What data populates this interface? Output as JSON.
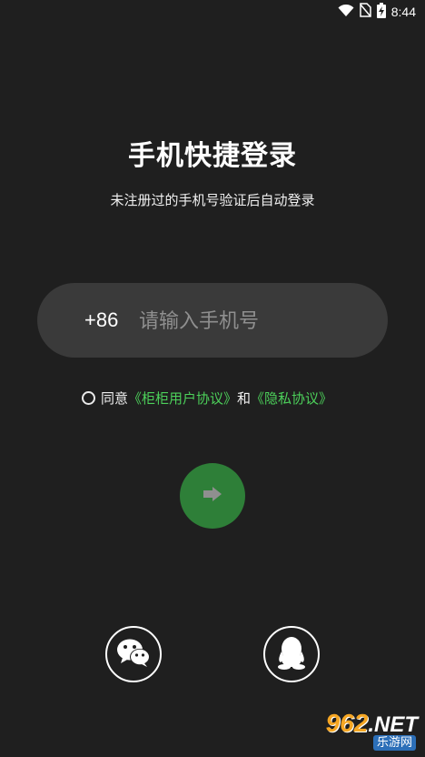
{
  "status_bar": {
    "time": "8:44",
    "icons": [
      "wifi-icon",
      "no-sim-icon",
      "battery-charging-icon"
    ]
  },
  "login": {
    "title": "手机快捷登录",
    "subtitle": "未注册过的手机号验证后自动登录",
    "country_code": "+86",
    "phone_placeholder": "请输入手机号",
    "phone_value": ""
  },
  "agreement": {
    "prefix": "同意",
    "user_agreement": "《柜柜用户协议》",
    "conjunction": "和",
    "privacy_policy": "《隐私协议》",
    "checked": false
  },
  "submit": {
    "icon": "arrow-right-icon"
  },
  "social_login": [
    {
      "name": "wechat",
      "icon": "wechat-icon"
    },
    {
      "name": "qq",
      "icon": "qq-penguin-icon"
    }
  ],
  "watermark": {
    "top_num": "962",
    "top_net": ".NET",
    "bottom": "乐游网"
  },
  "colors": {
    "background": "#1f1f1f",
    "input_bg": "#3a3a3a",
    "link_green": "#4cd05a",
    "button_green": "#2e7f38"
  }
}
